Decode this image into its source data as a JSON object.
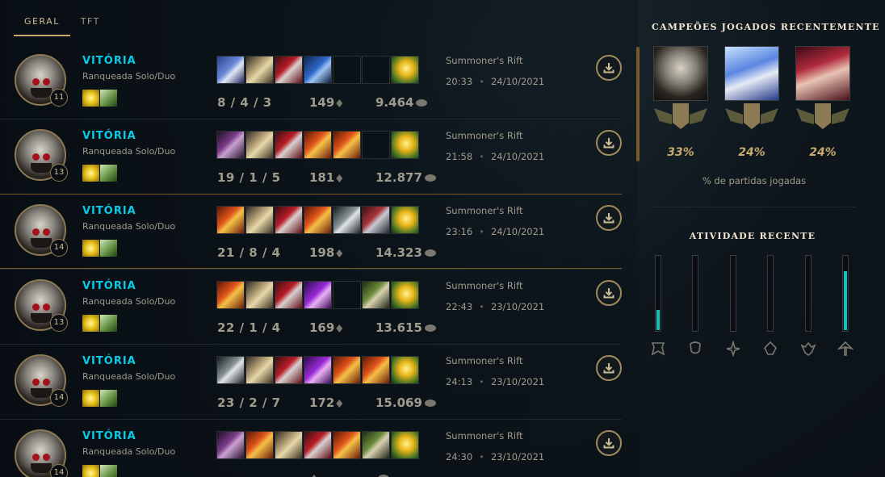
{
  "tabs": [
    {
      "label": "GERAL",
      "active": true
    },
    {
      "label": "TFT",
      "active": false
    }
  ],
  "matches": [
    {
      "result": "VITÓRIA",
      "queue": "Ranqueada Solo/Duo",
      "level": "11",
      "kda": "8 / 4 / 3",
      "cs": "149",
      "gold": "9.464",
      "map": "Summoner's Rift",
      "time": "20:33",
      "date": "24/10/2021",
      "items": [
        "blue",
        "boots",
        "red",
        "axe",
        "empty",
        "empty",
        "trinket"
      ]
    },
    {
      "result": "VITÓRIA",
      "queue": "Ranqueada Solo/Duo",
      "level": "13",
      "kda": "19 / 1 / 5",
      "cs": "181",
      "gold": "12.877",
      "map": "Summoner's Rift",
      "time": "21:58",
      "date": "24/10/2021",
      "items": [
        "dagger",
        "boots",
        "red",
        "fire",
        "fire",
        "empty",
        "trinket"
      ]
    },
    {
      "result": "VITÓRIA",
      "queue": "Ranqueada Solo/Duo",
      "level": "14",
      "kda": "21 / 8 / 4",
      "cs": "198",
      "gold": "14.323",
      "map": "Summoner's Rift",
      "time": "23:16",
      "date": "24/10/2021",
      "items": [
        "fire",
        "boots",
        "red",
        "fire",
        "sword",
        "rage",
        "trinket"
      ]
    },
    {
      "result": "VITÓRIA",
      "queue": "Ranqueada Solo/Duo",
      "level": "13",
      "kda": "22 / 1 / 4",
      "cs": "169",
      "gold": "13.615",
      "map": "Summoner's Rift",
      "time": "22:43",
      "date": "23/10/2021",
      "items": [
        "fire",
        "boots",
        "red",
        "purple",
        "empty",
        "green",
        "trinket"
      ]
    },
    {
      "result": "VITÓRIA",
      "queue": "Ranqueada Solo/Duo",
      "level": "14",
      "kda": "23 / 2 / 7",
      "cs": "172",
      "gold": "15.069",
      "map": "Summoner's Rift",
      "time": "24:13",
      "date": "23/10/2021",
      "items": [
        "sword",
        "boots",
        "red",
        "purple",
        "fire",
        "fire",
        "trinket"
      ]
    },
    {
      "result": "VITÓRIA",
      "queue": "Ranqueada Solo/Duo",
      "level": "14",
      "kda": "",
      "cs": "",
      "gold": "",
      "map": "Summoner's Rift",
      "time": "24:30",
      "date": "23/10/2021",
      "items": [
        "dagger",
        "fire",
        "boots",
        "red",
        "fire",
        "green",
        "trinket"
      ]
    }
  ],
  "recent": {
    "title": "CAMPEÕES JOGADOS RECENTEMENTE",
    "champions": [
      {
        "pct": "33%"
      },
      {
        "pct": "24%"
      },
      {
        "pct": "24%"
      }
    ],
    "caption": "% de partidas jogadas"
  },
  "activity": {
    "title": "ATIVIDADE RECENTE",
    "roles": [
      {
        "icon": "top-role-icon",
        "level": 0.27
      },
      {
        "icon": "jungle-role-icon",
        "level": 0
      },
      {
        "icon": "mid-role-icon",
        "level": 0
      },
      {
        "icon": "bot-role-icon",
        "level": 0
      },
      {
        "icon": "support-role-icon",
        "level": 0
      },
      {
        "icon": "fill-role-icon",
        "level": 0.79
      }
    ]
  },
  "colors": {
    "win": "#0acbe6",
    "gold": "#c8aa6e",
    "accent": "#0ac8b9"
  }
}
